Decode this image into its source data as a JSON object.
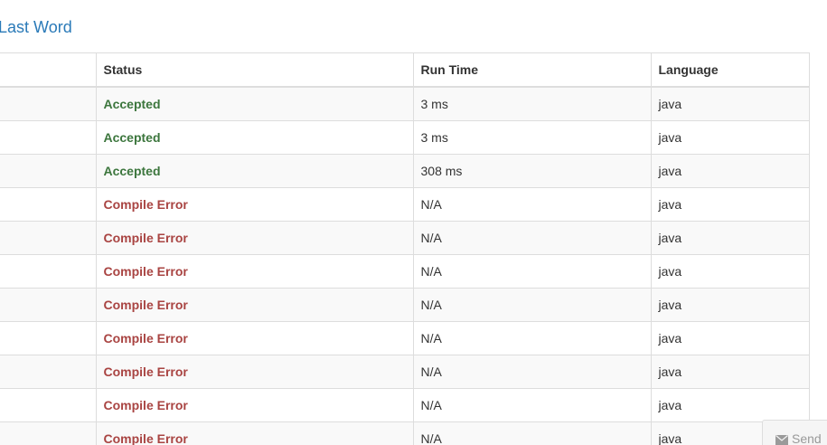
{
  "header": {
    "title_link": "Last Word"
  },
  "table": {
    "columns": [
      "",
      "Status",
      "Run Time",
      "Language"
    ],
    "rows": [
      {
        "status": "Accepted",
        "status_type": "accepted",
        "run_time": "3 ms",
        "language": "java"
      },
      {
        "status": "Accepted",
        "status_type": "accepted",
        "run_time": "3 ms",
        "language": "java"
      },
      {
        "status": "Accepted",
        "status_type": "accepted",
        "run_time": "308 ms",
        "language": "java"
      },
      {
        "status": "Compile Error",
        "status_type": "error",
        "run_time": "N/A",
        "language": "java"
      },
      {
        "status": "Compile Error",
        "status_type": "error",
        "run_time": "N/A",
        "language": "java"
      },
      {
        "status": "Compile Error",
        "status_type": "error",
        "run_time": "N/A",
        "language": "java"
      },
      {
        "status": "Compile Error",
        "status_type": "error",
        "run_time": "N/A",
        "language": "java"
      },
      {
        "status": "Compile Error",
        "status_type": "error",
        "run_time": "N/A",
        "language": "java"
      },
      {
        "status": "Compile Error",
        "status_type": "error",
        "run_time": "N/A",
        "language": "java"
      },
      {
        "status": "Compile Error",
        "status_type": "error",
        "run_time": "N/A",
        "language": "java"
      },
      {
        "status": "Compile Error",
        "status_type": "error",
        "run_time": "N/A",
        "language": "java"
      }
    ]
  },
  "send_tab": {
    "label": "Send",
    "icon": "envelope-icon"
  },
  "colors": {
    "link": "#2a7ab8",
    "accepted": "#3c763d",
    "error": "#a94442"
  }
}
